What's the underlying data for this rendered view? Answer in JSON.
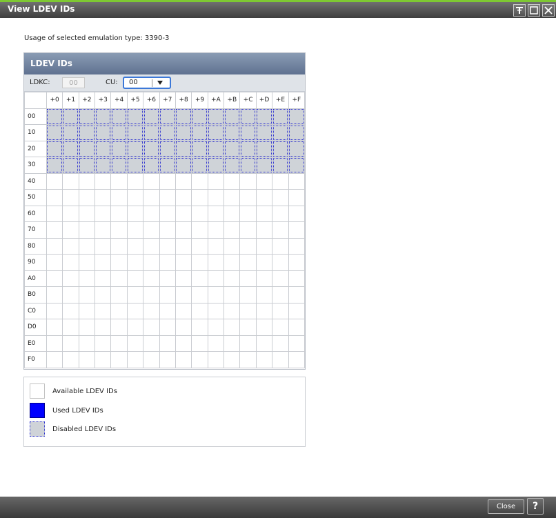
{
  "window": {
    "title": "View LDEV IDs",
    "controls": [
      "pin-icon",
      "maximize-icon",
      "close-icon"
    ],
    "accent_color": "#7ec832"
  },
  "usage": {
    "label": "Usage of selected emulation type:",
    "value": "3390-3"
  },
  "panel": {
    "title": "LDEV IDs",
    "ldkc_label": "LDKC:",
    "ldkc_value": "00",
    "cu_label": "CU:",
    "cu_value": "00"
  },
  "grid": {
    "columns": [
      "+0",
      "+1",
      "+2",
      "+3",
      "+4",
      "+5",
      "+6",
      "+7",
      "+8",
      "+9",
      "+A",
      "+B",
      "+C",
      "+D",
      "+E",
      "+F"
    ],
    "rows": [
      {
        "label": "00",
        "state": "disabled"
      },
      {
        "label": "10",
        "state": "disabled"
      },
      {
        "label": "20",
        "state": "disabled"
      },
      {
        "label": "30",
        "state": "disabled"
      },
      {
        "label": "40",
        "state": "available"
      },
      {
        "label": "50",
        "state": "available"
      },
      {
        "label": "60",
        "state": "available"
      },
      {
        "label": "70",
        "state": "available"
      },
      {
        "label": "80",
        "state": "available"
      },
      {
        "label": "90",
        "state": "available"
      },
      {
        "label": "A0",
        "state": "available"
      },
      {
        "label": "B0",
        "state": "available"
      },
      {
        "label": "C0",
        "state": "available"
      },
      {
        "label": "D0",
        "state": "available"
      },
      {
        "label": "E0",
        "state": "available"
      },
      {
        "label": "F0",
        "state": "available"
      }
    ]
  },
  "legend": {
    "available": "Available LDEV IDs",
    "used": "Used LDEV IDs",
    "disabled": "Disabled LDEV IDs",
    "used_color": "#0000ff",
    "disabled_color": "#cfd3d8"
  },
  "footer": {
    "close_label": "Close",
    "help_label": "?"
  }
}
